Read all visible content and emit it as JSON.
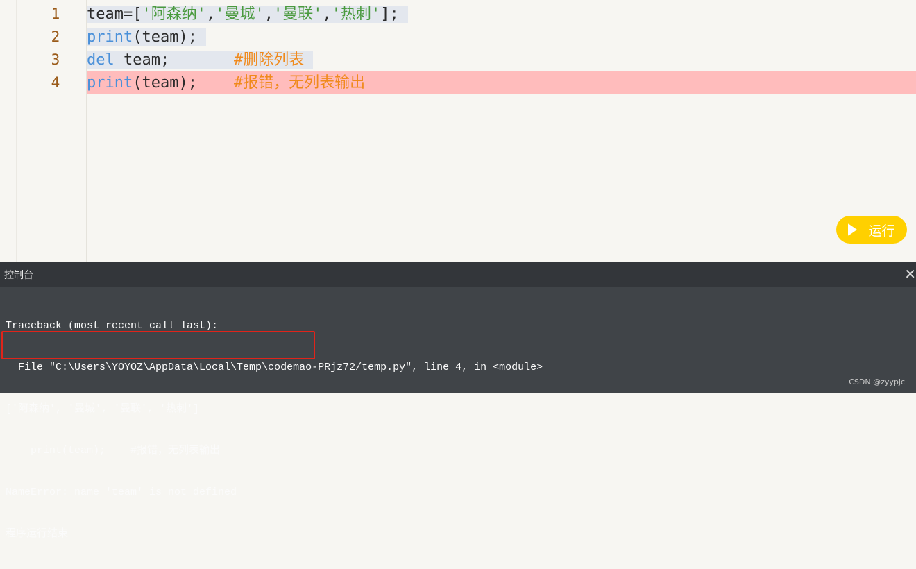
{
  "editor": {
    "lines": [
      {
        "num": "1",
        "tokens": {
          "a": "team=[",
          "s1": "'阿森纳'",
          "c1": ",",
          "s2": "'曼城'",
          "c2": ",",
          "s3": "'曼联'",
          "c3": ",",
          "s4": "'热刺'",
          "end": "];"
        }
      },
      {
        "num": "2",
        "tokens": {
          "kw": "print",
          "rest": "(team);"
        }
      },
      {
        "num": "3",
        "tokens": {
          "kw": "del",
          "rest": " team;",
          "pad": "       ",
          "comment": "#删除列表"
        }
      },
      {
        "num": "4",
        "tokens": {
          "kw": "print",
          "rest": "(team);",
          "pad": "    ",
          "comment": "#报错，无列表输出"
        }
      }
    ],
    "error_line": "4"
  },
  "run_button": {
    "label": "运行",
    "icon": "play-icon",
    "color": "#ffd000"
  },
  "console": {
    "title": "控制台",
    "close_glyph": "✕",
    "output": [
      "Traceback (most recent call last):",
      "  File \"C:\\Users\\YOYOZ\\AppData\\Local\\Temp\\codemao-PRjz72/temp.py\", line 4, in <module>",
      "['阿森纳', '曼城', '曼联', '热刺']",
      "    print(team);    #报错，无列表输出",
      "NameError: name 'team' is not defined",
      "程序运行结束"
    ]
  },
  "watermark": "CSDN @zyypjc"
}
